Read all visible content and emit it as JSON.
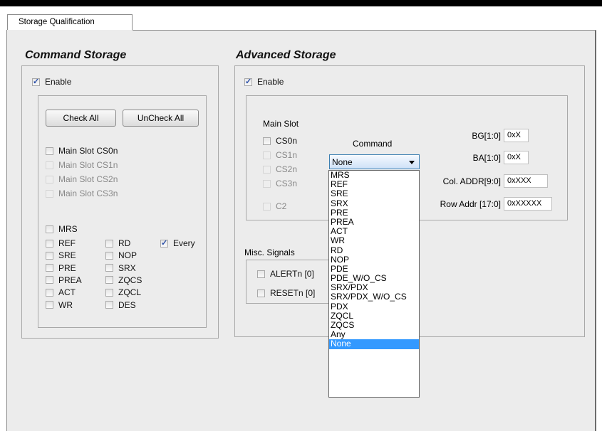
{
  "tab": {
    "label": "Storage Qualification"
  },
  "command_storage": {
    "title": "Command Storage",
    "enable": {
      "label": "Enable",
      "checked": true
    },
    "check_all": "Check All",
    "uncheck_all": "UnCheck All",
    "slots": [
      {
        "label": "Main Slot CS0n",
        "enabled": true
      },
      {
        "label": "Main Slot CS1n",
        "enabled": false
      },
      {
        "label": "Main Slot CS2n",
        "enabled": false
      },
      {
        "label": "Main Slot CS3n",
        "enabled": false
      }
    ],
    "mrs": "MRS",
    "col1": [
      "REF",
      "SRE",
      "PRE",
      "PREA",
      "ACT",
      "WR"
    ],
    "col2": [
      "RD",
      "NOP",
      "SRX",
      "ZQCS",
      "ZQCL",
      "DES"
    ],
    "every": {
      "label": "Every",
      "checked": true
    }
  },
  "advanced_storage": {
    "title": "Advanced Storage",
    "enable": {
      "label": "Enable",
      "checked": true
    },
    "main_slot_label": "Main Slot",
    "slots": [
      {
        "label": "CS0n",
        "enabled": true
      },
      {
        "label": "CS1n",
        "enabled": false
      },
      {
        "label": "CS2n",
        "enabled": false
      },
      {
        "label": "CS3n",
        "enabled": false
      }
    ],
    "c2": "C2",
    "command_label": "Command",
    "command_value": "None",
    "fields": [
      {
        "label": "BG[1:0]",
        "value": "0xX"
      },
      {
        "label": "BA[1:0]",
        "value": "0xX"
      },
      {
        "label": "Col. ADDR[9:0]",
        "value": "0xXXX"
      },
      {
        "label": "Row Addr [17:0]",
        "value": "0xXXXXX"
      }
    ],
    "misc_label": "Misc. Signals",
    "misc": [
      "ALERTn [0]",
      "RESETn [0]"
    ]
  },
  "command_options": [
    "MRS",
    "REF",
    "SRE",
    "SRX",
    "PRE",
    "PREA",
    "ACT",
    "WR",
    "RD",
    "NOP",
    "PDE",
    "PDE_W/O_CS",
    "SRX/PDX",
    "SRX/PDX_W/O_CS",
    "PDX",
    "ZQCL",
    "ZQCS",
    "Any",
    "None"
  ],
  "selected_option": "None"
}
